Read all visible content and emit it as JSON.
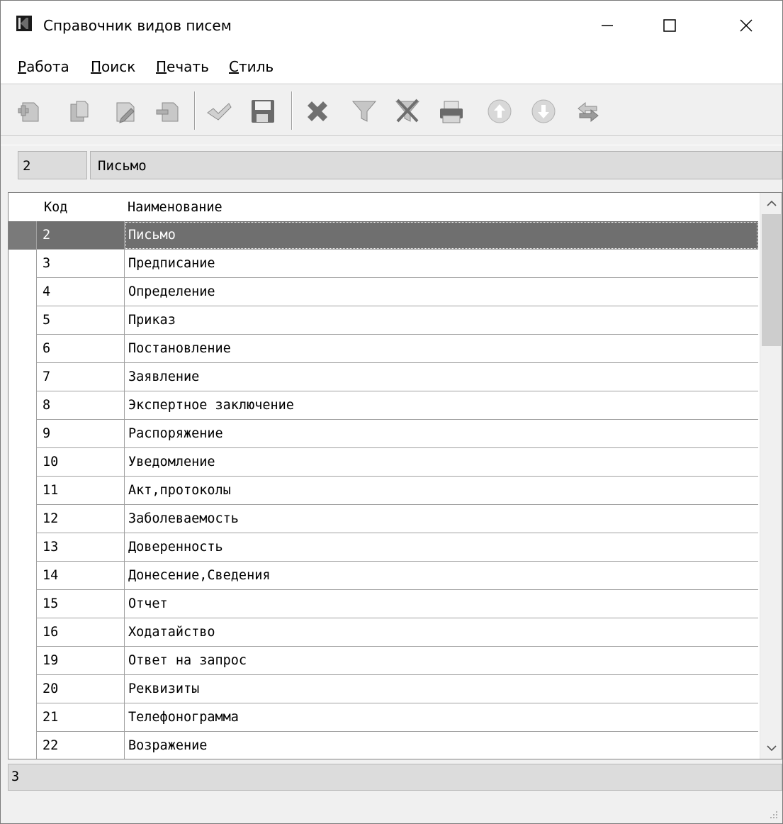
{
  "window": {
    "title": "Справочник видов писем"
  },
  "menu": [
    {
      "accel": "Р",
      "rest": "абота"
    },
    {
      "accel": "П",
      "rest": "оиск"
    },
    {
      "accel": "П",
      "rest": "ечать"
    },
    {
      "accel": "С",
      "rest": "тиль"
    }
  ],
  "toolbar": {
    "icons": [
      "add-record-icon",
      "copy-record-icon",
      "edit-record-icon",
      "delete-record-icon",
      "confirm-icon",
      "save-icon",
      "cancel-icon",
      "filter-icon",
      "clear-filter-icon",
      "print-icon",
      "move-up-icon",
      "move-down-icon",
      "refresh-icon"
    ]
  },
  "current": {
    "code": "2",
    "name": "Письмо"
  },
  "grid": {
    "columns": [
      "Код",
      "Наименование"
    ],
    "selected_index": 0,
    "rows": [
      {
        "code": "2",
        "name": "Письмо"
      },
      {
        "code": "3",
        "name": "Предписание"
      },
      {
        "code": "4",
        "name": "Определение"
      },
      {
        "code": "5",
        "name": "Приказ"
      },
      {
        "code": "6",
        "name": "Постановление"
      },
      {
        "code": "7",
        "name": "Заявление"
      },
      {
        "code": "8",
        "name": "Экспертное заключение"
      },
      {
        "code": "9",
        "name": "Распоряжение"
      },
      {
        "code": "10",
        "name": "Уведомление"
      },
      {
        "code": "11",
        "name": "Акт,протоколы"
      },
      {
        "code": "12",
        "name": "Заболеваемость"
      },
      {
        "code": "13",
        "name": "Доверенность"
      },
      {
        "code": "14",
        "name": "Донесение,Сведения"
      },
      {
        "code": "15",
        "name": "Отчет"
      },
      {
        "code": "16",
        "name": "Ходатайство"
      },
      {
        "code": "19",
        "name": "Ответ на запрос"
      },
      {
        "code": "20",
        "name": "Реквизиты"
      },
      {
        "code": "21",
        "name": "Телефонограмма"
      },
      {
        "code": "22",
        "name": "Возражение"
      }
    ]
  },
  "status": {
    "text": "3"
  }
}
